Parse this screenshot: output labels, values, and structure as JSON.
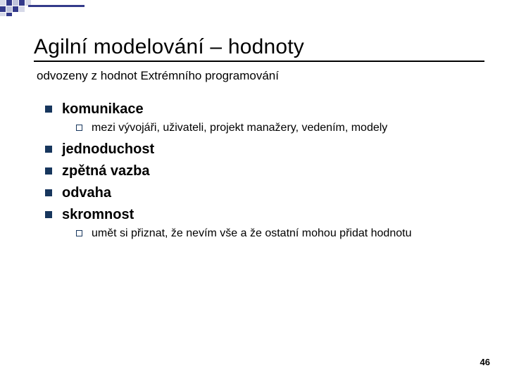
{
  "title": "Agilní modelování – hodnoty",
  "subtitle": "odvozeny z hodnot Extrémního programování",
  "items": [
    {
      "label": "komunikace",
      "sub": [
        "mezi vývojáři, uživateli, projekt manažery, vedením, modely"
      ]
    },
    {
      "label": "jednoduchost"
    },
    {
      "label": "zpětná vazba"
    },
    {
      "label": "odvaha"
    },
    {
      "label": "skromnost",
      "sub": [
        "umět si přiznat, že nevím vše a že ostatní mohou přidat hodnotu"
      ]
    }
  ],
  "page_number": "46"
}
